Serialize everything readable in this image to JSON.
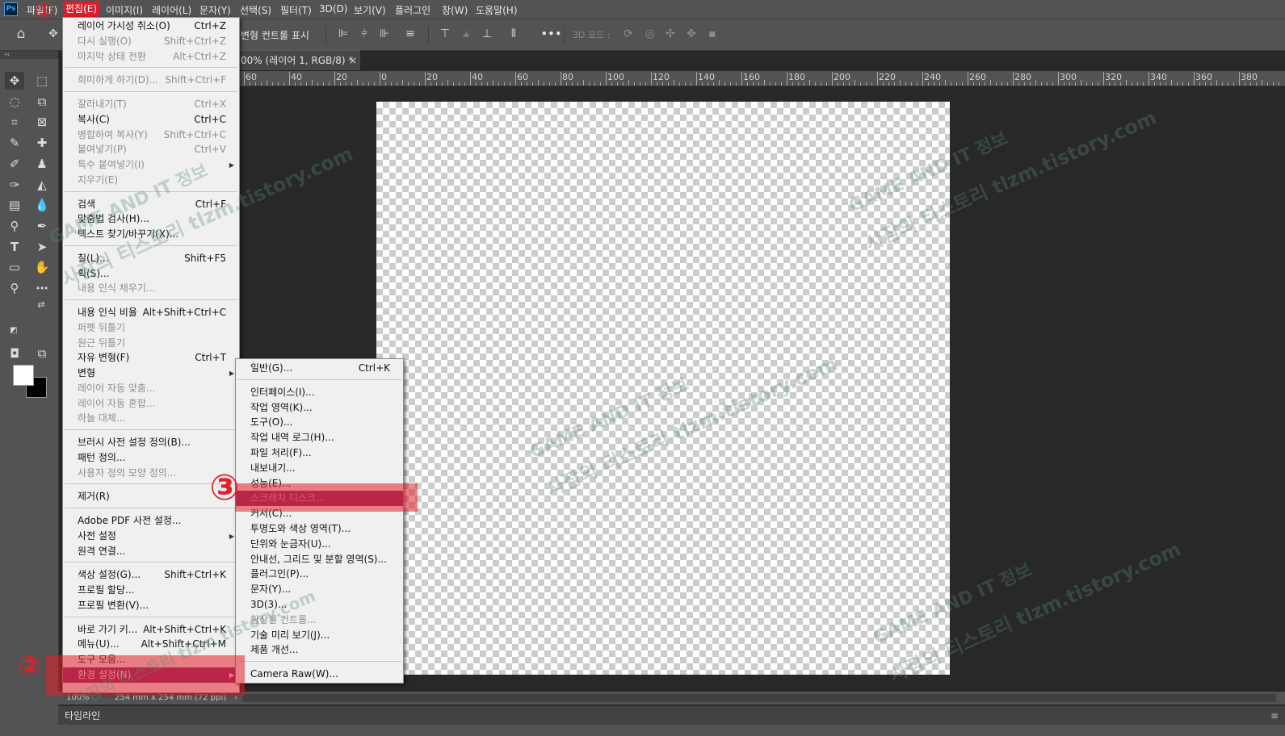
{
  "app": {
    "logo": "Ps"
  },
  "menubar": {
    "items": [
      "파일(F)",
      "편집(E)",
      "이미지(I)",
      "레이어(L)",
      "문자(Y)",
      "선택(S)",
      "필터(T)",
      "3D(D)",
      "보기(V)",
      "플러그인",
      "창(W)",
      "도움말(H)"
    ]
  },
  "options_bar": {
    "transform_label": "변형 컨트롤 표시",
    "mode3d_label": "3D 모드 :",
    "more_label": "•••"
  },
  "document": {
    "tab_title": "00% (레이어 1, RGB/8) *",
    "close_glyph": "×",
    "ruler": [
      "60",
      "40",
      "20",
      "0",
      "20",
      "40",
      "60",
      "80",
      "100",
      "120",
      "140",
      "160",
      "180",
      "200",
      "220",
      "240",
      "260",
      "280",
      "300",
      "320",
      "340",
      "360",
      "380"
    ]
  },
  "status_bar": {
    "zoom": "100%",
    "doc_size": "254 mm x 254 mm (72 ppi)",
    "arrow": "›"
  },
  "timeline": {
    "label": "타임라인"
  },
  "collapse_glyph": "‹‹",
  "edit_menu": {
    "items": [
      {
        "label": "레이어 가시성 취소(O)",
        "shortcut": "Ctrl+Z",
        "disabled": false
      },
      {
        "label": "다시 실행(O)",
        "shortcut": "Shift+Ctrl+Z",
        "disabled": true
      },
      {
        "label": "마지막 상태 전환",
        "shortcut": "Alt+Ctrl+Z",
        "disabled": true
      },
      {
        "label": "희미하게 하기(D)...",
        "shortcut": "Shift+Ctrl+F",
        "disabled": true
      },
      {
        "label": "잘라내기(T)",
        "shortcut": "Ctrl+X",
        "disabled": true
      },
      {
        "label": "복사(C)",
        "shortcut": "Ctrl+C",
        "disabled": false
      },
      {
        "label": "병합하여 복사(Y)",
        "shortcut": "Shift+Ctrl+C",
        "disabled": true
      },
      {
        "label": "붙여넣기(P)",
        "shortcut": "Ctrl+V",
        "disabled": true
      },
      {
        "label": "특수 붙여넣기(I)",
        "shortcut": "",
        "disabled": true,
        "submenu": true
      },
      {
        "label": "지우기(E)",
        "shortcut": "",
        "disabled": true
      },
      {
        "label": "검색",
        "shortcut": "Ctrl+F",
        "disabled": false
      },
      {
        "label": "맞춤법 검사(H)...",
        "shortcut": "",
        "disabled": false
      },
      {
        "label": "텍스트 찾기/바꾸기(X)...",
        "shortcut": "",
        "disabled": false
      },
      {
        "label": "칠(L)...",
        "shortcut": "Shift+F5",
        "disabled": false
      },
      {
        "label": "획(S)...",
        "shortcut": "",
        "disabled": false
      },
      {
        "label": "내용 인식 채우기...",
        "shortcut": "",
        "disabled": true
      },
      {
        "label": "내용 인식 비율",
        "shortcut": "Alt+Shift+Ctrl+C",
        "disabled": false
      },
      {
        "label": "퍼펫 뒤틀기",
        "shortcut": "",
        "disabled": true
      },
      {
        "label": "원근 뒤틀기",
        "shortcut": "",
        "disabled": true
      },
      {
        "label": "자유 변형(F)",
        "shortcut": "Ctrl+T",
        "disabled": false
      },
      {
        "label": "변형",
        "shortcut": "",
        "disabled": false,
        "submenu": true
      },
      {
        "label": "레이어 자동 맞춤...",
        "shortcut": "",
        "disabled": true
      },
      {
        "label": "레이어 자동 혼합...",
        "shortcut": "",
        "disabled": true
      },
      {
        "label": "하늘 대체...",
        "shortcut": "",
        "disabled": true
      },
      {
        "label": "브러시 사전 설정 정의(B)...",
        "shortcut": "",
        "disabled": false
      },
      {
        "label": "패턴 정의...",
        "shortcut": "",
        "disabled": false
      },
      {
        "label": "사용자 정의 모양 정의...",
        "shortcut": "",
        "disabled": true
      },
      {
        "label": "제거(R)",
        "shortcut": "",
        "disabled": false
      },
      {
        "label": "Adobe PDF 사전 설정...",
        "shortcut": "",
        "disabled": false
      },
      {
        "label": "사전 설정",
        "shortcut": "",
        "disabled": false,
        "submenu": true
      },
      {
        "label": "원격 연결...",
        "shortcut": "",
        "disabled": false
      },
      {
        "label": "색상 설정(G)...",
        "shortcut": "Shift+Ctrl+K",
        "disabled": false
      },
      {
        "label": "프로필 할당...",
        "shortcut": "",
        "disabled": false
      },
      {
        "label": "프로필 변환(V)...",
        "shortcut": "",
        "disabled": false
      },
      {
        "label": "바로 가기 키...",
        "shortcut": "Alt+Shift+Ctrl+K",
        "disabled": false
      },
      {
        "label": "메뉴(U)...",
        "shortcut": "Alt+Shift+Ctrl+M",
        "disabled": false
      },
      {
        "label": "도구 모음...",
        "shortcut": "",
        "disabled": false
      },
      {
        "label": "환경 설정(N)",
        "shortcut": "",
        "disabled": false,
        "submenu": true,
        "highlighted": true
      }
    ]
  },
  "prefs_submenu": {
    "items": [
      {
        "label": "일반(G)...",
        "shortcut": "Ctrl+K"
      },
      {
        "label": "인터페이스(I)...",
        "shortcut": ""
      },
      {
        "label": "작업 영역(K)...",
        "shortcut": ""
      },
      {
        "label": "도구(O)...",
        "shortcut": ""
      },
      {
        "label": "작업 내역 로그(H)...",
        "shortcut": ""
      },
      {
        "label": "파일 처리(F)...",
        "shortcut": ""
      },
      {
        "label": "내보내기...",
        "shortcut": ""
      },
      {
        "label": "성능(E)...",
        "shortcut": ""
      },
      {
        "label": "스크래치 디스크...",
        "shortcut": "",
        "highlighted": true
      },
      {
        "label": "커서(C)...",
        "shortcut": ""
      },
      {
        "label": "투명도와 색상 영역(T)...",
        "shortcut": ""
      },
      {
        "label": "단위와 눈금자(U)...",
        "shortcut": ""
      },
      {
        "label": "안내선, 그리드 및 분할 영역(S)...",
        "shortcut": ""
      },
      {
        "label": "플러그인(P)...",
        "shortcut": ""
      },
      {
        "label": "문자(Y)...",
        "shortcut": ""
      },
      {
        "label": "3D(3)...",
        "shortcut": ""
      },
      {
        "label": "향상된 컨트롤...",
        "shortcut": "",
        "disabled": true
      },
      {
        "label": "기술 미리 보기(J)...",
        "shortcut": ""
      },
      {
        "label": "제품 개선...",
        "shortcut": ""
      },
      {
        "label": "Camera Raw(W)...",
        "shortcut": ""
      }
    ]
  },
  "annotations": {
    "step1": "①",
    "step2": "②",
    "step3": "③"
  },
  "watermarks": {
    "line1": "GAME AND IT 정보",
    "line2": "사잠의 티스토리 tlzm.tistory.com"
  },
  "colors": {
    "highlight": "#8b2d68",
    "annotation_red": "#e2202c",
    "foreground_swatch": "#ffffff",
    "background_swatch": "#000000"
  }
}
